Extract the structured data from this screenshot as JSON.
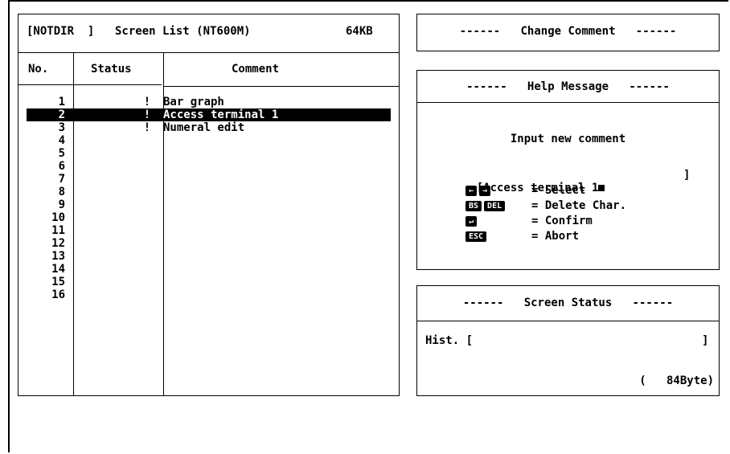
{
  "list_panel": {
    "header": {
      "dir": "[NOTDIR  ]",
      "title": "Screen List (NT600M)",
      "memory": "64KB"
    },
    "columns": {
      "no": "No.",
      "status": "Status",
      "comment": "Comment"
    },
    "rows": [
      {
        "no": "1",
        "status": "!",
        "comment": "Bar graph"
      },
      {
        "no": "2",
        "status": "!",
        "comment": "Access terminal 1"
      },
      {
        "no": "3",
        "status": "!",
        "comment": "Numeral edit"
      },
      {
        "no": "4",
        "status": "",
        "comment": ""
      },
      {
        "no": "5",
        "status": "",
        "comment": ""
      },
      {
        "no": "6",
        "status": "",
        "comment": ""
      },
      {
        "no": "7",
        "status": "",
        "comment": ""
      },
      {
        "no": "8",
        "status": "",
        "comment": ""
      },
      {
        "no": "9",
        "status": "",
        "comment": ""
      },
      {
        "no": "10",
        "status": "",
        "comment": ""
      },
      {
        "no": "11",
        "status": "",
        "comment": ""
      },
      {
        "no": "12",
        "status": "",
        "comment": ""
      },
      {
        "no": "13",
        "status": "",
        "comment": ""
      },
      {
        "no": "14",
        "status": "",
        "comment": ""
      },
      {
        "no": "15",
        "status": "",
        "comment": ""
      },
      {
        "no": "16",
        "status": "",
        "comment": ""
      }
    ],
    "selected_row": "2"
  },
  "change_comment": {
    "title": "------   Change Comment   ------"
  },
  "help_message": {
    "title": "------   Help Message   ------",
    "prompt": "Input new comment",
    "input_open": "[Access terminal 1",
    "input_close": "]",
    "keys": [
      {
        "keys": [
          "←",
          "→"
        ],
        "action": "= Select"
      },
      {
        "keys": [
          "BS",
          "DEL"
        ],
        "action": "= Delete Char."
      },
      {
        "keys": [
          "↵"
        ],
        "action": "= Confirm"
      },
      {
        "keys": [
          "ESC"
        ],
        "action": "= Abort"
      }
    ]
  },
  "screen_status": {
    "title": "------   Screen Status   ------",
    "hist_label": "Hist. [",
    "hist_close": "]",
    "size": "(   84Byte)"
  }
}
